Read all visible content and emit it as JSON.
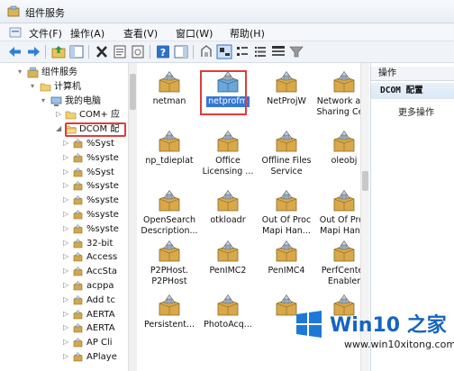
{
  "window": {
    "title": "组件服务"
  },
  "menu": [
    "文件(F)",
    "操作(A)",
    "查看(V)",
    "窗口(W)",
    "帮助(H)"
  ],
  "tree": [
    {
      "label": "组件服务",
      "level": 0,
      "icon": "component-services-icon",
      "arrow": "▾"
    },
    {
      "label": "计算机",
      "level": 1,
      "icon": "folder-icon",
      "arrow": "▾"
    },
    {
      "label": "我的电脑",
      "level": 2,
      "icon": "computer-icon",
      "arrow": "▾"
    },
    {
      "label": "COM+ 应",
      "level": 3,
      "icon": "folder-icon",
      "arrow": "▷"
    },
    {
      "label": "DCOM 配",
      "level": 3,
      "icon": "folder-open-icon",
      "arrow": "◢"
    },
    {
      "label": "%Syst",
      "level": 4,
      "icon": "package-icon",
      "arrow": "▷"
    },
    {
      "label": "%syste",
      "level": 4,
      "icon": "package-icon",
      "arrow": "▷"
    },
    {
      "label": "%Syst",
      "level": 4,
      "icon": "package-icon",
      "arrow": "▷"
    },
    {
      "label": "%syste",
      "level": 4,
      "icon": "package-icon",
      "arrow": "▷"
    },
    {
      "label": "%syste",
      "level": 4,
      "icon": "package-icon",
      "arrow": "▷"
    },
    {
      "label": "%syste",
      "level": 4,
      "icon": "package-icon",
      "arrow": "▷"
    },
    {
      "label": "%syste",
      "level": 4,
      "icon": "package-icon",
      "arrow": "▷"
    },
    {
      "label": "32-bit",
      "level": 4,
      "icon": "package-icon",
      "arrow": "▷"
    },
    {
      "label": "Access",
      "level": 4,
      "icon": "package-icon",
      "arrow": "▷"
    },
    {
      "label": "AccSta",
      "level": 4,
      "icon": "package-icon",
      "arrow": "▷"
    },
    {
      "label": "acppa",
      "level": 4,
      "icon": "package-icon",
      "arrow": "▷"
    },
    {
      "label": "Add tc",
      "level": 4,
      "icon": "package-icon",
      "arrow": "▷"
    },
    {
      "label": "AERTA",
      "level": 4,
      "icon": "package-icon",
      "arrow": "▷"
    },
    {
      "label": "AERTA",
      "level": 4,
      "icon": "package-icon",
      "arrow": "▷"
    },
    {
      "label": "AP Cli",
      "level": 4,
      "icon": "package-icon",
      "arrow": "▷"
    },
    {
      "label": "APlaye",
      "level": 4,
      "icon": "package-icon",
      "arrow": "▷"
    }
  ],
  "items": [
    {
      "label": "netman",
      "selected": false
    },
    {
      "label": "netprofm",
      "selected": true
    },
    {
      "label": "NetProjW",
      "selected": false
    },
    {
      "label": "Network and Sharing Ce...",
      "selected": false
    },
    {
      "label": "np_tdieplat",
      "selected": false
    },
    {
      "label": "Office Licensing ...",
      "selected": false
    },
    {
      "label": "Offline Files Service",
      "selected": false
    },
    {
      "label": "oleobj",
      "selected": false
    },
    {
      "label": "OpenSearch Description...",
      "selected": false
    },
    {
      "label": "otkloadr",
      "selected": false
    },
    {
      "label": "Out Of Proc Mapi Han...",
      "selected": false
    },
    {
      "label": "Out Of Proc Mapi Han...",
      "selected": false
    },
    {
      "label": "P2PHost. P2PHost",
      "selected": false
    },
    {
      "label": "PenIMC2",
      "selected": false
    },
    {
      "label": "PenIMC4",
      "selected": false
    },
    {
      "label": "PerfCenter Enabler",
      "selected": false
    },
    {
      "label": "Persistent...",
      "selected": false
    },
    {
      "label": "PhotoAcq...",
      "selected": false
    },
    {
      "label": "",
      "selected": false
    },
    {
      "label": "",
      "selected": false
    }
  ],
  "actions": {
    "header": "操作",
    "section": "DCOM 配置",
    "more": "更多操作"
  },
  "watermark": {
    "title_en": "Win10",
    "title_zh": "之家",
    "url": "www.win10xitong.com"
  },
  "colors": {
    "selection": "#3478d4",
    "highlight_box": "#e03b3b",
    "watermark_blue": "#1565c0"
  }
}
